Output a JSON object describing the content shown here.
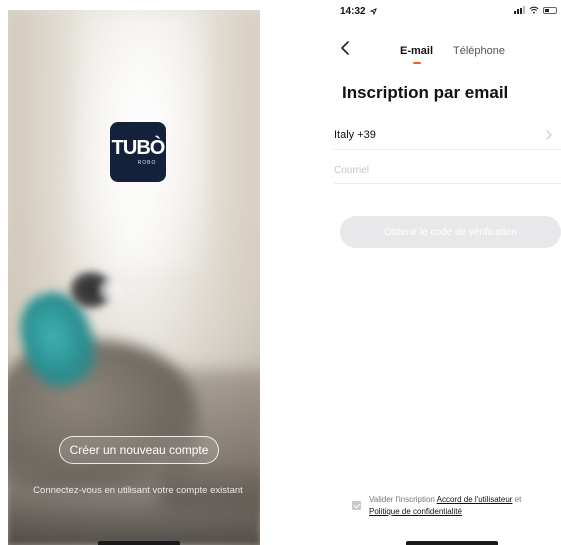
{
  "left_screen": {
    "logo": {
      "brand": "TUBÒ",
      "sub": "ROBO",
      "background_color": "#14213a"
    },
    "create_account_label": "Créer un nouveau compte",
    "login_hint": "Connectez-vous en utilisant votre compte existant"
  },
  "right_screen": {
    "status_bar": {
      "time": "14:32"
    },
    "back_icon": "chevron-left-icon",
    "tabs": [
      {
        "label": "E-mail",
        "active": true
      },
      {
        "label": "Téléphone",
        "active": false
      }
    ],
    "accent_color": "#ff5a1f",
    "page_title": "Inscription par email",
    "country": {
      "value": "Italy +39"
    },
    "email": {
      "value": "",
      "placeholder": "Courriel"
    },
    "verify_button_label": "Obtenir le code de vérification",
    "agreement": {
      "checked": true,
      "prefix": "Valider l'inscription",
      "user_agreement_link": "Accord de l'utilisateur",
      "conjunction": "et",
      "privacy_policy_link": "Politique de confidentialité"
    }
  }
}
